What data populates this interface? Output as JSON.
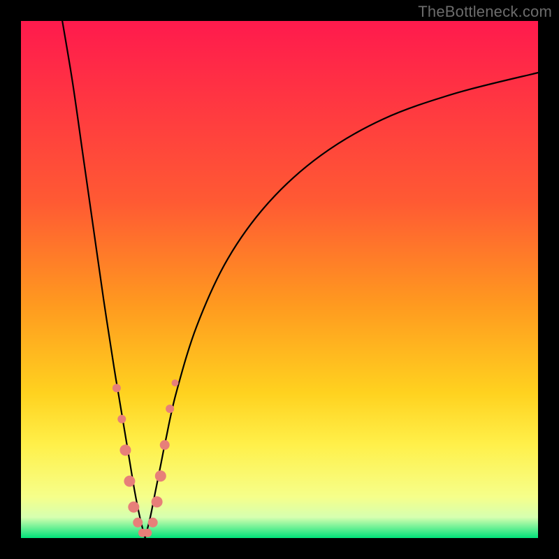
{
  "watermark": "TheBottleneck.com",
  "gradient_colors": {
    "c0": "#ff1a4d",
    "c1": "#ff5a33",
    "c2": "#ff9a1f",
    "c3": "#ffd21f",
    "c4": "#fff04a",
    "c5": "#f6ff8a",
    "c6": "#d6ffb0",
    "c7": "#00e27a"
  },
  "curve_style": {
    "stroke": "#000000",
    "width": 2.2
  },
  "marker_style": {
    "fill": "#e77f79",
    "radius_min": 5,
    "radius_max": 9
  },
  "chart_data": {
    "type": "line",
    "title": "",
    "xlabel": "",
    "ylabel": "",
    "xlim": [
      0,
      100
    ],
    "ylim": [
      0,
      100
    ],
    "note": "V-shaped bottleneck curve; y is approximate percentage read from the vertical gradient, x is position across the plot width. Markers cluster near the trough.",
    "series": [
      {
        "name": "left-branch",
        "x": [
          8,
          10,
          12,
          14,
          16,
          18,
          19,
          20,
          21,
          22,
          23,
          24
        ],
        "y": [
          100,
          88,
          74,
          60,
          46,
          33,
          27,
          21,
          15,
          9,
          4,
          0
        ]
      },
      {
        "name": "right-branch",
        "x": [
          24,
          25,
          26,
          27,
          28,
          30,
          34,
          40,
          48,
          58,
          70,
          84,
          100
        ],
        "y": [
          0,
          4,
          9,
          14,
          19,
          28,
          41,
          54,
          65,
          74,
          81,
          86,
          90
        ]
      }
    ],
    "markers": [
      {
        "x": 18.5,
        "y": 29,
        "r": 6
      },
      {
        "x": 19.5,
        "y": 23,
        "r": 6
      },
      {
        "x": 20.2,
        "y": 17,
        "r": 8
      },
      {
        "x": 21.0,
        "y": 11,
        "r": 8
      },
      {
        "x": 21.8,
        "y": 6,
        "r": 8
      },
      {
        "x": 22.6,
        "y": 3,
        "r": 7
      },
      {
        "x": 23.5,
        "y": 1,
        "r": 6
      },
      {
        "x": 24.5,
        "y": 1,
        "r": 6
      },
      {
        "x": 25.5,
        "y": 3,
        "r": 7
      },
      {
        "x": 26.3,
        "y": 7,
        "r": 8
      },
      {
        "x": 27.0,
        "y": 12,
        "r": 8
      },
      {
        "x": 27.8,
        "y": 18,
        "r": 7
      },
      {
        "x": 28.8,
        "y": 25,
        "r": 6
      },
      {
        "x": 29.8,
        "y": 30,
        "r": 5
      }
    ]
  }
}
